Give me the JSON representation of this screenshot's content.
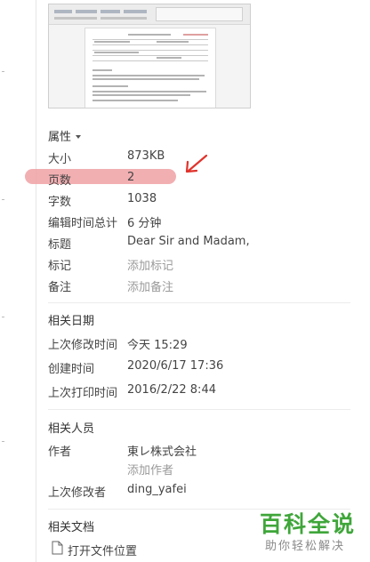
{
  "properties": {
    "section_title": "属性",
    "rows": [
      {
        "label": "大小",
        "value": "873KB"
      },
      {
        "label": "页数",
        "value": "2"
      },
      {
        "label": "字数",
        "value": "1038"
      },
      {
        "label": "编辑时间总计",
        "value": "6 分钟"
      },
      {
        "label": "标题",
        "value": "Dear Sir and Madam,"
      },
      {
        "label": "标记",
        "value": "添加标记"
      },
      {
        "label": "备注",
        "value": "添加备注"
      }
    ]
  },
  "dates": {
    "section_title": "相关日期",
    "rows": [
      {
        "label": "上次修改时间",
        "value": "今天 15:29"
      },
      {
        "label": "创建时间",
        "value": "2020/6/17 17:36"
      },
      {
        "label": "上次打印时间",
        "value": "2016/2/22 8:44"
      }
    ]
  },
  "people": {
    "section_title": "相关人员",
    "author_label": "作者",
    "author_value": "東レ株式会社",
    "add_author": "添加作者",
    "last_modified_by_label": "上次修改者",
    "last_modified_by_value": "ding_yafei"
  },
  "documents": {
    "section_title": "相关文档",
    "open_location": "打开文件位置"
  },
  "watermark": {
    "brand": "百科全说",
    "slogan": "助你轻松解决"
  },
  "colors": {
    "highlight": "#f0a1a5",
    "arrow": "#e0332b",
    "watermark_green": "#3fa63a"
  }
}
